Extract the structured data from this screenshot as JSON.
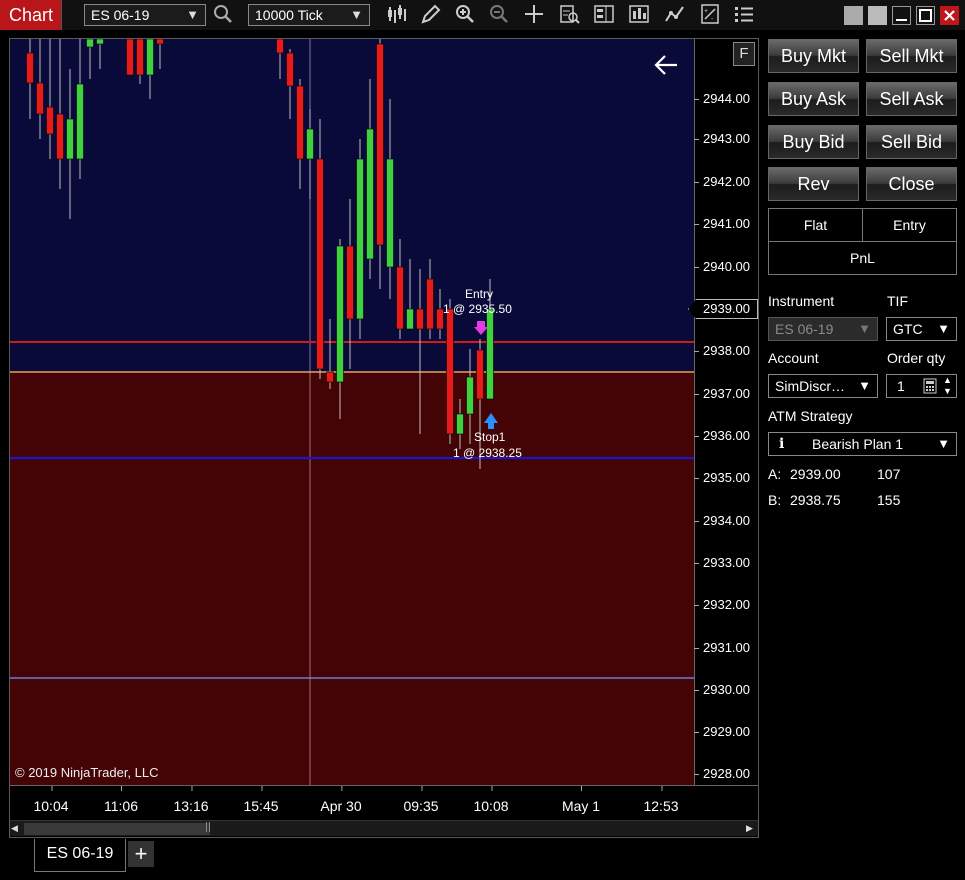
{
  "window": {
    "title": "Chart"
  },
  "toolbar": {
    "instrument": "ES 06-19",
    "interval": "10000 Tick"
  },
  "chart": {
    "f_button": "F",
    "current_price_flag": "2939.00",
    "copyright": "© 2019 NinjaTrader, LLC",
    "y_ticks": [
      "2944.00",
      "2943.00",
      "2942.00",
      "2941.00",
      "2940.00",
      "2938.00",
      "2937.00",
      "2936.00",
      "2935.00",
      "2934.00",
      "2933.00",
      "2932.00",
      "2931.00",
      "2930.00",
      "2929.00",
      "2928.00"
    ],
    "x_ticks": [
      "10:04",
      "11:06",
      "13:16",
      "15:45",
      "Apr 30",
      "09:35",
      "10:08",
      "May 1",
      "12:53"
    ],
    "entry_label": "Entry",
    "entry_detail": "1 @ 2935.50",
    "stop_label": "Stop1",
    "stop_detail": "1 @ 2938.25",
    "colors": {
      "up": "#3fd13f",
      "down": "#e81b1b",
      "upper_zone": "#09093a",
      "lower_zone": "#440405",
      "stop_line": "#d11a1a",
      "entry_line": "#1f14c8",
      "mid_line": "#e8a25a",
      "low_line": "#6f7cd8"
    }
  },
  "tabs": {
    "active": "ES 06-19",
    "add": "+"
  },
  "panel": {
    "buttons": {
      "buy_mkt": "Buy Mkt",
      "sell_mkt": "Sell Mkt",
      "buy_ask": "Buy Ask",
      "sell_ask": "Sell Ask",
      "buy_bid": "Buy Bid",
      "sell_bid": "Sell Bid",
      "rev": "Rev",
      "close": "Close"
    },
    "position": {
      "flat": "Flat",
      "entry": "Entry",
      "pnl": "PnL"
    },
    "instrument_label": "Instrument",
    "instrument_value": "ES 06-19",
    "tif_label": "TIF",
    "tif_value": "GTC",
    "account_label": "Account",
    "account_value": "SimDiscr…",
    "order_qty_label": "Order qty",
    "order_qty_value": "1",
    "atm_label": "ATM Strategy",
    "atm_value": "Bearish Plan 1",
    "ask_label": "A:",
    "ask_price": "2939.00",
    "ask_size": "107",
    "bid_label": "B:",
    "bid_price": "2938.75",
    "bid_size": "155"
  }
}
